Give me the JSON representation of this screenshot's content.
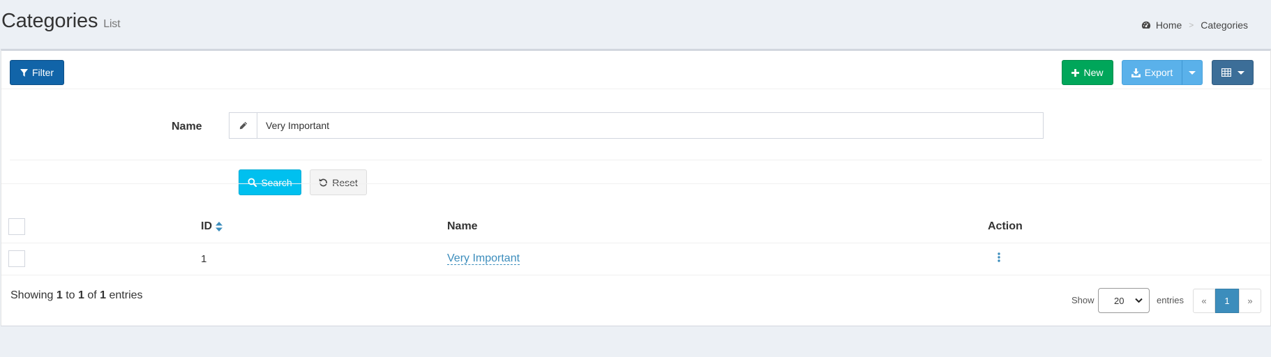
{
  "header": {
    "title": "Categories",
    "subtitle": "List",
    "breadcrumb": {
      "home": "Home",
      "current": "Categories"
    }
  },
  "toolbar": {
    "filter_label": "Filter",
    "new_label": "New",
    "export_label": "Export"
  },
  "filter": {
    "name_label": "Name",
    "name_value": "Very Important",
    "search_label": "Search",
    "reset_label": "Reset"
  },
  "table": {
    "columns": [
      "ID",
      "Name",
      "Action"
    ],
    "rows": [
      {
        "id": "1",
        "name": "Very Important"
      }
    ]
  },
  "pagination": {
    "showing_prefix": "Showing",
    "from": "1",
    "to_word": "to",
    "to": "1",
    "of_word": "of",
    "total": "1",
    "entries_word": "entries",
    "show_label": "Show",
    "page_size": "20",
    "entries_label": "entries",
    "prev": "«",
    "current_page": "1",
    "next": "»"
  },
  "colors": {
    "filter_button": "#1164a8",
    "new_button": "#00a65a",
    "export_button": "#5ab1ea",
    "columns_button": "#3c6e98",
    "search_button": "#00c0ef",
    "link": "#3c8dbc",
    "background": "#ecf0f5"
  },
  "icons": {
    "breadcrumb_home": "dashboard-icon",
    "filter": "filter-icon",
    "new": "plus-icon",
    "export": "download-icon",
    "columns": "table-grid-icon",
    "name_addon": "pencil-icon",
    "search": "search-icon",
    "reset": "undo-icon",
    "sort": "sort-icon",
    "action": "vertical-ellipsis-icon"
  }
}
